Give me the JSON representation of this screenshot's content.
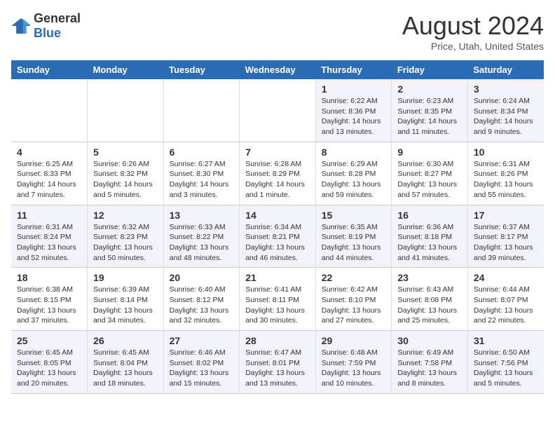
{
  "logo": {
    "general": "General",
    "blue": "Blue"
  },
  "header": {
    "month": "August 2024",
    "location": "Price, Utah, United States"
  },
  "days_of_week": [
    "Sunday",
    "Monday",
    "Tuesday",
    "Wednesday",
    "Thursday",
    "Friday",
    "Saturday"
  ],
  "weeks": [
    [
      {
        "day": "",
        "info": ""
      },
      {
        "day": "",
        "info": ""
      },
      {
        "day": "",
        "info": ""
      },
      {
        "day": "",
        "info": ""
      },
      {
        "day": "1",
        "info": "Sunrise: 6:22 AM\nSunset: 8:36 PM\nDaylight: 14 hours and 13 minutes."
      },
      {
        "day": "2",
        "info": "Sunrise: 6:23 AM\nSunset: 8:35 PM\nDaylight: 14 hours and 11 minutes."
      },
      {
        "day": "3",
        "info": "Sunrise: 6:24 AM\nSunset: 8:34 PM\nDaylight: 14 hours and 9 minutes."
      }
    ],
    [
      {
        "day": "4",
        "info": "Sunrise: 6:25 AM\nSunset: 8:33 PM\nDaylight: 14 hours and 7 minutes."
      },
      {
        "day": "5",
        "info": "Sunrise: 6:26 AM\nSunset: 8:32 PM\nDaylight: 14 hours and 5 minutes."
      },
      {
        "day": "6",
        "info": "Sunrise: 6:27 AM\nSunset: 8:30 PM\nDaylight: 14 hours and 3 minutes."
      },
      {
        "day": "7",
        "info": "Sunrise: 6:28 AM\nSunset: 8:29 PM\nDaylight: 14 hours and 1 minute."
      },
      {
        "day": "8",
        "info": "Sunrise: 6:29 AM\nSunset: 8:28 PM\nDaylight: 13 hours and 59 minutes."
      },
      {
        "day": "9",
        "info": "Sunrise: 6:30 AM\nSunset: 8:27 PM\nDaylight: 13 hours and 57 minutes."
      },
      {
        "day": "10",
        "info": "Sunrise: 6:31 AM\nSunset: 8:26 PM\nDaylight: 13 hours and 55 minutes."
      }
    ],
    [
      {
        "day": "11",
        "info": "Sunrise: 6:31 AM\nSunset: 8:24 PM\nDaylight: 13 hours and 52 minutes."
      },
      {
        "day": "12",
        "info": "Sunrise: 6:32 AM\nSunset: 8:23 PM\nDaylight: 13 hours and 50 minutes."
      },
      {
        "day": "13",
        "info": "Sunrise: 6:33 AM\nSunset: 8:22 PM\nDaylight: 13 hours and 48 minutes."
      },
      {
        "day": "14",
        "info": "Sunrise: 6:34 AM\nSunset: 8:21 PM\nDaylight: 13 hours and 46 minutes."
      },
      {
        "day": "15",
        "info": "Sunrise: 6:35 AM\nSunset: 8:19 PM\nDaylight: 13 hours and 44 minutes."
      },
      {
        "day": "16",
        "info": "Sunrise: 6:36 AM\nSunset: 8:18 PM\nDaylight: 13 hours and 41 minutes."
      },
      {
        "day": "17",
        "info": "Sunrise: 6:37 AM\nSunset: 8:17 PM\nDaylight: 13 hours and 39 minutes."
      }
    ],
    [
      {
        "day": "18",
        "info": "Sunrise: 6:38 AM\nSunset: 8:15 PM\nDaylight: 13 hours and 37 minutes."
      },
      {
        "day": "19",
        "info": "Sunrise: 6:39 AM\nSunset: 8:14 PM\nDaylight: 13 hours and 34 minutes."
      },
      {
        "day": "20",
        "info": "Sunrise: 6:40 AM\nSunset: 8:12 PM\nDaylight: 13 hours and 32 minutes."
      },
      {
        "day": "21",
        "info": "Sunrise: 6:41 AM\nSunset: 8:11 PM\nDaylight: 13 hours and 30 minutes."
      },
      {
        "day": "22",
        "info": "Sunrise: 6:42 AM\nSunset: 8:10 PM\nDaylight: 13 hours and 27 minutes."
      },
      {
        "day": "23",
        "info": "Sunrise: 6:43 AM\nSunset: 8:08 PM\nDaylight: 13 hours and 25 minutes."
      },
      {
        "day": "24",
        "info": "Sunrise: 6:44 AM\nSunset: 8:07 PM\nDaylight: 13 hours and 22 minutes."
      }
    ],
    [
      {
        "day": "25",
        "info": "Sunrise: 6:45 AM\nSunset: 8:05 PM\nDaylight: 13 hours and 20 minutes."
      },
      {
        "day": "26",
        "info": "Sunrise: 6:45 AM\nSunset: 8:04 PM\nDaylight: 13 hours and 18 minutes."
      },
      {
        "day": "27",
        "info": "Sunrise: 6:46 AM\nSunset: 8:02 PM\nDaylight: 13 hours and 15 minutes."
      },
      {
        "day": "28",
        "info": "Sunrise: 6:47 AM\nSunset: 8:01 PM\nDaylight: 13 hours and 13 minutes."
      },
      {
        "day": "29",
        "info": "Sunrise: 6:48 AM\nSunset: 7:59 PM\nDaylight: 13 hours and 10 minutes."
      },
      {
        "day": "30",
        "info": "Sunrise: 6:49 AM\nSunset: 7:58 PM\nDaylight: 13 hours and 8 minutes."
      },
      {
        "day": "31",
        "info": "Sunrise: 6:50 AM\nSunset: 7:56 PM\nDaylight: 13 hours and 5 minutes."
      }
    ]
  ]
}
